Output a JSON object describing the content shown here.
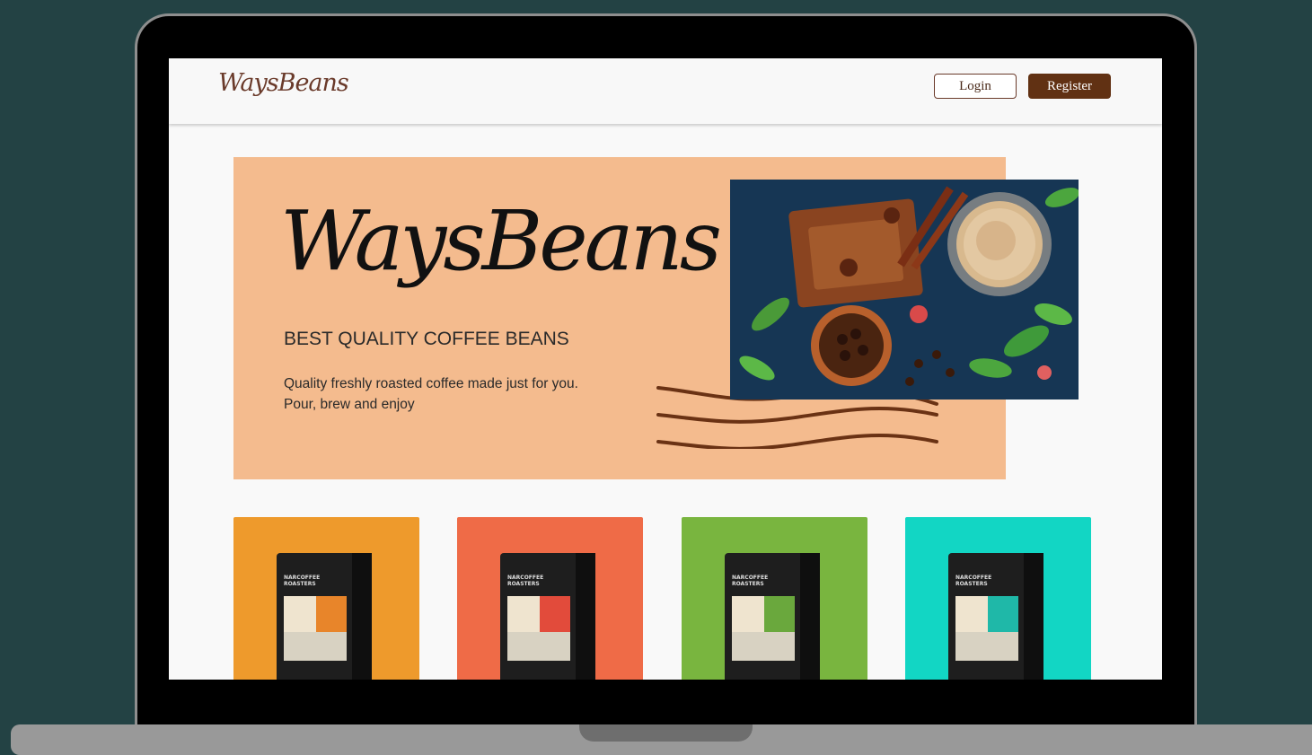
{
  "navbar": {
    "logo_text": "WaysBeans",
    "login_label": "Login",
    "register_label": "Register"
  },
  "hero": {
    "logo_text": "WaysBeans",
    "tagline": "BEST QUALITY COFFEE BEANS",
    "description_line1": "Quality freshly roasted coffee made just for you.",
    "description_line2": "Pour, brew and enjoy"
  },
  "products": [
    {
      "card_color": "#ee9a2c",
      "accent_color": "#e8852a"
    },
    {
      "card_color": "#ef6b47",
      "accent_color": "#e24b3b"
    },
    {
      "card_color": "#79b53f",
      "accent_color": "#6aa83d"
    },
    {
      "card_color": "#12d6c4",
      "accent_color": "#1fb8a8"
    }
  ],
  "colors": {
    "background": "#234244",
    "brand_brown": "#613113",
    "hero_bg": "#f4bb8e"
  }
}
